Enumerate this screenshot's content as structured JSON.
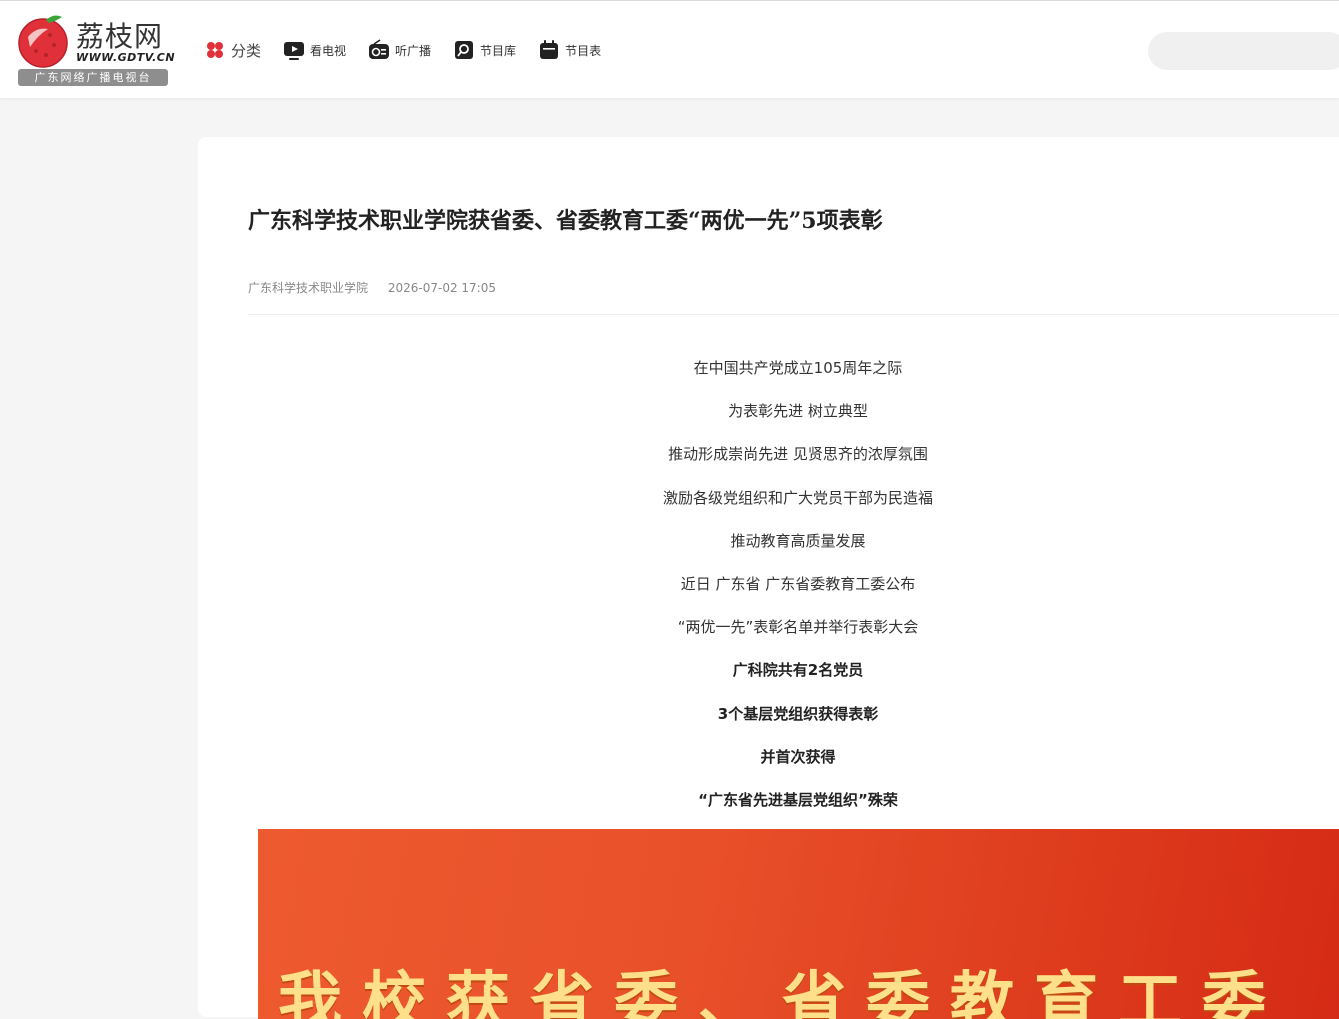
{
  "header": {
    "logo": {
      "name": "荔枝网",
      "domain": "WWW.GDTV.CN",
      "tagline": "广东网络广播电视台"
    },
    "nav": [
      {
        "label": "分类",
        "icon": "category-icon"
      },
      {
        "label": "看电视",
        "icon": "tv-play-icon"
      },
      {
        "label": "听广播",
        "icon": "radio-icon"
      },
      {
        "label": "节目库",
        "icon": "program-library-icon"
      },
      {
        "label": "节目表",
        "icon": "schedule-icon"
      }
    ],
    "search": {
      "value": "",
      "placeholder": ""
    }
  },
  "article": {
    "title": "广东科学技术职业学院获省委、省委教育工委“两优一先”5项表彰",
    "source": "广东科学技术职业学院",
    "datetime": "2026-07-02 17:05",
    "paragraphs": [
      {
        "text": "在中国共产党成立105周年之际",
        "bold": false
      },
      {
        "text": "为表彰先进 树立典型",
        "bold": false
      },
      {
        "text": "推动形成崇尚先进 见贤思齐的浓厚氛围",
        "bold": false
      },
      {
        "text": "激励各级党组织和广大党员干部为民造福",
        "bold": false
      },
      {
        "text": "推动教育高质量发展",
        "bold": false
      },
      {
        "text": "近日 广东省 广东省委教育工委公布",
        "bold": false
      },
      {
        "text": "“两优一先”表彰名单并举行表彰大会",
        "bold": false
      },
      {
        "text": "广科院共有2名党员",
        "bold": true
      },
      {
        "text": "3个基层党组织获得表彰",
        "bold": true
      },
      {
        "text": "并首次获得",
        "bold": true
      },
      {
        "text": "“广东省先进基层党组织”殊荣",
        "bold": true
      }
    ],
    "banner_text": "我校获省委、省委教育工委"
  },
  "colors": {
    "brand_red": "#e0313b",
    "banner_red": "#e8502a",
    "banner_text": "#ffe08a"
  }
}
